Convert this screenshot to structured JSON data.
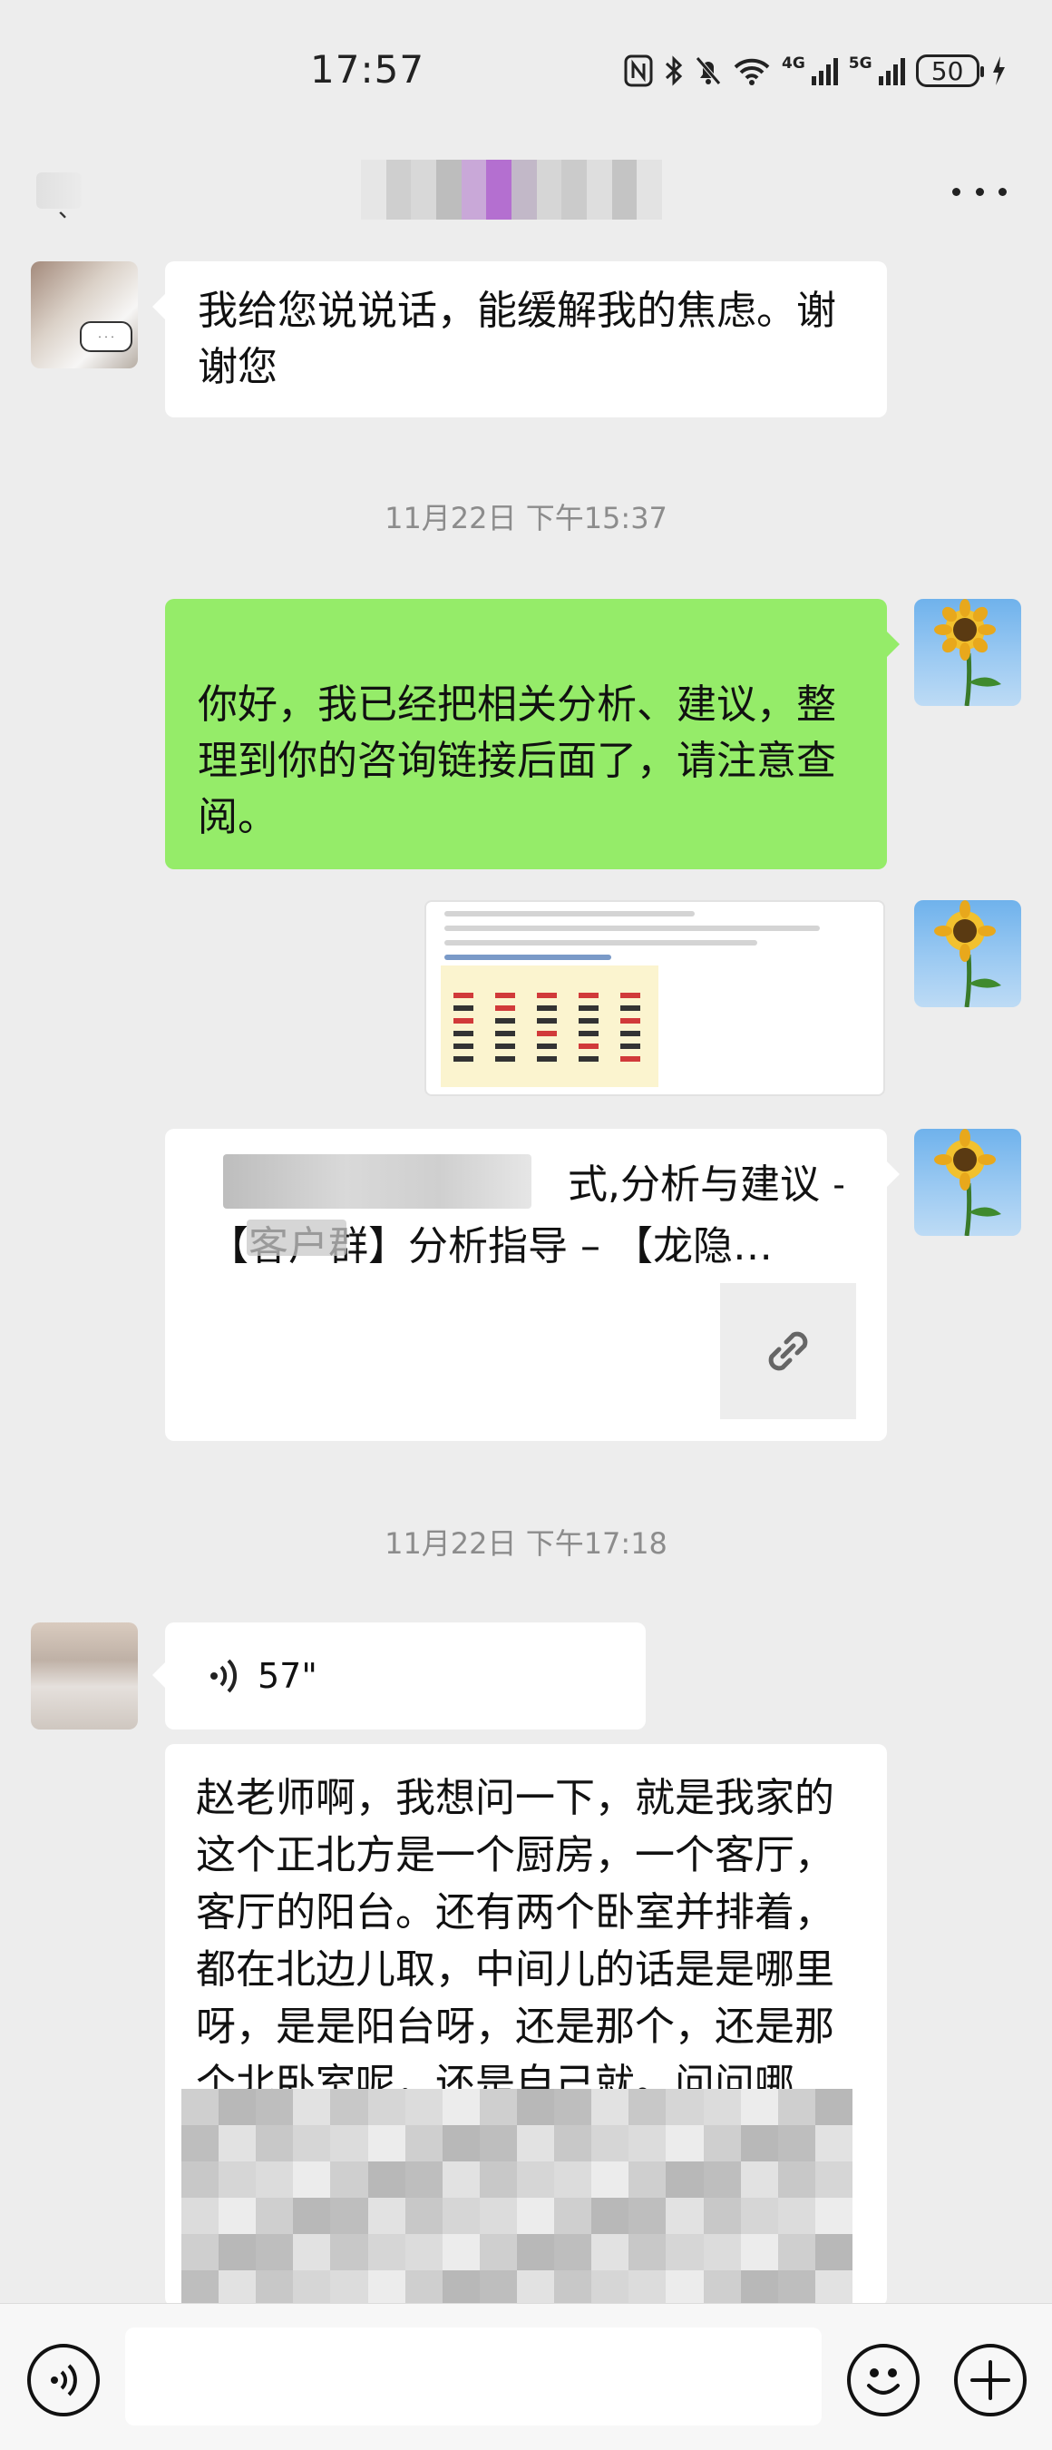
{
  "status_bar": {
    "time": "17:57",
    "network_4g": "4G",
    "network_5g": "5G",
    "battery": "50"
  },
  "header": {
    "back_label": "、",
    "more_icon": "more-dots-icon"
  },
  "messages": {
    "m1_text": "我给您说说话，能缓解我的焦虑。谢谢您",
    "ts1": "11月22日 下午15:37",
    "m2_text": "你好，我已经把相关分析、建议，整理到你的咨询链接后面了，请注意查阅。",
    "link_title_line1": "　　　　　　　　　式,分析与建议 –",
    "link_title_line2": "【客户群】分析指导 – 【龙隐…",
    "link_icon": "link-icon",
    "ts2": "11月22日 下午17:18",
    "voice_duration": "57\"",
    "long_text": "赵老师啊，我想问一下，就是我家的这个正北方是一个厨房，一个客厅，客厅的阳台。还有两个卧室并排着，都在北边儿取，中间儿的话是是哪里呀，是是阳台呀，还是那个，还是那个北卧室呢，还是自己就。问问哪边，哪边"
  },
  "input_bar": {
    "voice_icon": "voice-mode-icon",
    "emoji_icon": "emoji-icon",
    "plus_icon": "plus-icon"
  },
  "colors": {
    "background": "#ededed",
    "bubble_green": "#95ec69",
    "bubble_white": "#ffffff"
  }
}
